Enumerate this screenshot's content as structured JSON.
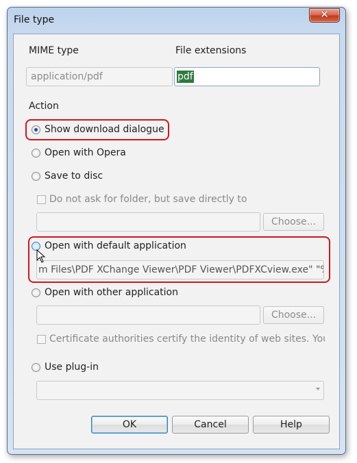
{
  "window": {
    "title": "File type",
    "close_glyph": "✕"
  },
  "mime_type": {
    "label": "MIME type",
    "value": "application/pdf"
  },
  "file_extensions": {
    "label": "File extensions",
    "value": "pdf"
  },
  "action": {
    "label": "Action",
    "options": {
      "show_download": {
        "label": "Show download dialogue",
        "checked": true
      },
      "open_with_opera": {
        "label": "Open with Opera",
        "checked": false
      },
      "save_to_disc": {
        "label": "Save to disc",
        "checked": false
      },
      "open_default": {
        "label": "Open with default application",
        "checked": false
      },
      "open_other": {
        "label": "Open with other application",
        "checked": false
      },
      "use_plugin": {
        "label": "Use plug-in",
        "checked": false
      }
    }
  },
  "save_to_disc": {
    "no_ask_checkbox": "Do not ask for folder, but save directly to",
    "folder_value": "",
    "choose_label": "Choose..."
  },
  "default_app": {
    "path": "m Files\\PDF XChange Viewer\\PDF Viewer\\PDFXCview.exe\" \"%s\""
  },
  "other_app": {
    "path_value": "",
    "choose_label": "Choose...",
    "cert_checkbox": "Certificate authorities certify the identity of web sites. You sho"
  },
  "plugin": {
    "selected": ""
  },
  "buttons": {
    "ok": "OK",
    "cancel": "Cancel",
    "help": "Help"
  },
  "colors": {
    "highlight": "#d4141c",
    "selection": "#2e7a3f",
    "radio_dot": "#1d4b9a"
  },
  "icons": {
    "cursor": "arrow-cursor-icon",
    "dropdown": "chevron-down-icon"
  }
}
